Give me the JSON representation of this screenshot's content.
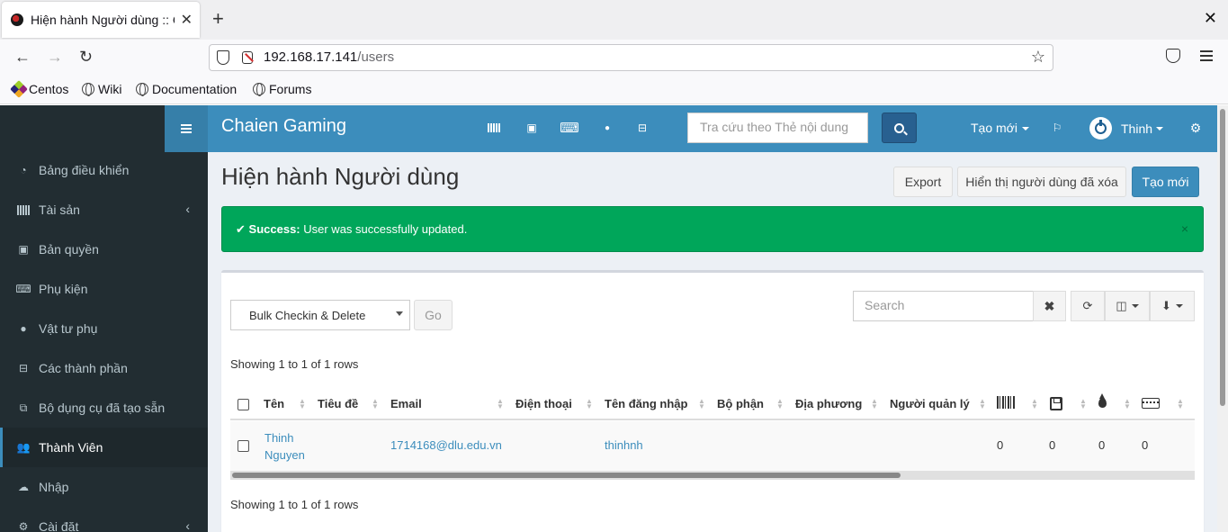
{
  "browser": {
    "tab_title": "Hiện hành Người dùng :: C",
    "url_host": "192.168.17.141",
    "url_path": "/users",
    "bookmarks": [
      "Centos",
      "Wiki",
      "Documentation",
      "Forums"
    ]
  },
  "app": {
    "brand": "Chaien Gaming",
    "search_placeholder": "Tra cứu theo Thẻ nội dung",
    "create_new": "Tạo mới",
    "user_name": "Thinh",
    "accent_color": "#3c8dbc",
    "sidebar_bg": "#222d32",
    "success_color": "#00a65a"
  },
  "sidebar": {
    "items": [
      {
        "label": "Bảng điều khiển",
        "icon": "dashboard-icon"
      },
      {
        "label": "Tài sản",
        "icon": "barcode-icon"
      },
      {
        "label": "Bản quyền",
        "icon": "floppy-disk-icon"
      },
      {
        "label": "Phụ kiện",
        "icon": "keyboard-icon"
      },
      {
        "label": "Vật tư phụ",
        "icon": "tint-icon"
      },
      {
        "label": "Các thành phần",
        "icon": "hdd-icon"
      },
      {
        "label": "Bộ dụng cụ đã tạo sẵn",
        "icon": "object-group-icon"
      },
      {
        "label": "Thành Viên",
        "icon": "users-icon"
      },
      {
        "label": "Nhập",
        "icon": "cloud-upload-icon"
      },
      {
        "label": "Cài đặt",
        "icon": "cog-icon"
      }
    ]
  },
  "page": {
    "title": "Hiện hành Người dùng",
    "export_label": "Export",
    "show_deleted_label": "Hiển thị người dùng đã xóa",
    "create_label": "Tạo mới"
  },
  "alert": {
    "strong": "Success:",
    "message": "User was successfully updated.",
    "close": "×"
  },
  "table": {
    "bulk_action": "Bulk Checkin & Delete",
    "go_label": "Go",
    "search_placeholder": "Search",
    "showing_top": "Showing 1 to 1 of 1 rows",
    "showing_bottom": "Showing 1 to 1 of 1 rows",
    "columns": [
      "Tên",
      "Tiêu đề",
      "Email",
      "Điện thoại",
      "Tên đăng nhập",
      "Bộ phận",
      "Địa phương",
      "Người quản lý"
    ],
    "icon_columns": [
      "barcode-icon",
      "floppy-disk-icon",
      "tint-icon",
      "keyboard-icon"
    ],
    "rows": [
      {
        "name_line1": "Thinh",
        "name_line2": "Nguyen",
        "title": "",
        "email": "1714168@dlu.edu.vn",
        "phone": "",
        "username": "thinhnh",
        "department": "",
        "location": "",
        "manager": "",
        "assets": "0",
        "licenses": "0",
        "consumables": "0",
        "accessories": "0"
      }
    ]
  }
}
